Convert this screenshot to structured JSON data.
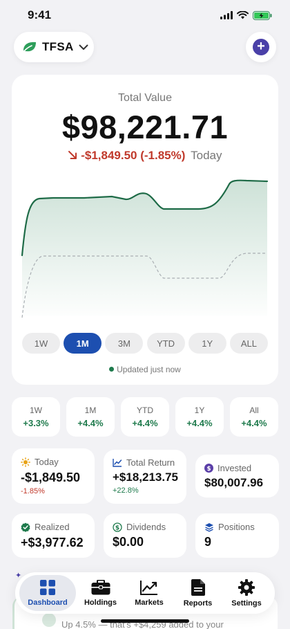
{
  "status_bar": {
    "time": "9:41"
  },
  "account": {
    "name": "TFSA",
    "icon": "leaf-icon"
  },
  "hero": {
    "label": "Total Value",
    "value": "$98,221.71",
    "change": "-$1,849.50 (-1.85%)",
    "change_period": "Today"
  },
  "ranges": [
    "1W",
    "1M",
    "3M",
    "YTD",
    "1Y",
    "ALL"
  ],
  "selected_range": "1M",
  "updated_text": "Updated just now",
  "performance": [
    {
      "period": "1W",
      "change": "+3.3%"
    },
    {
      "period": "1M",
      "change": "+4.4%"
    },
    {
      "period": "YTD",
      "change": "+4.4%"
    },
    {
      "period": "1Y",
      "change": "+4.4%"
    },
    {
      "period": "All",
      "change": "+4.4%"
    }
  ],
  "stats": {
    "today": {
      "label": "Today",
      "value": "-$1,849.50",
      "sub": "-1.85%"
    },
    "total_return": {
      "label": "Total Return",
      "value": "+$18,213.75",
      "sub": "+22.8%"
    },
    "invested": {
      "label": "Invested",
      "value": "$80,007.96"
    },
    "realized": {
      "label": "Realized",
      "value": "+$3,977.62"
    },
    "dividends": {
      "label": "Dividends",
      "value": "$0.00"
    },
    "positions": {
      "label": "Positions",
      "value": "9"
    }
  },
  "peek_text": "Up 4.5% — that's +$4,259 added to your",
  "tabs": [
    {
      "label": "Dashboard",
      "icon": "grid-icon"
    },
    {
      "label": "Holdings",
      "icon": "briefcase-icon"
    },
    {
      "label": "Markets",
      "icon": "trend-line-icon"
    },
    {
      "label": "Reports",
      "icon": "document-icon"
    },
    {
      "label": "Settings",
      "icon": "gear-icon"
    }
  ],
  "active_tab": "Dashboard",
  "colors": {
    "accent": "#1d4fb0",
    "positive": "#1e7a4c",
    "negative": "#c0392b",
    "add_button": "#4a40a8"
  }
}
